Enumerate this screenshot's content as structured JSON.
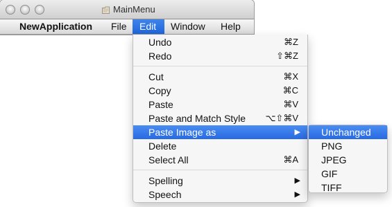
{
  "window": {
    "title": "MainMenu",
    "icon": "document-icon"
  },
  "menubar": {
    "items": [
      {
        "label": "NewApplication"
      },
      {
        "label": "File"
      },
      {
        "label": "Edit"
      },
      {
        "label": "Window"
      },
      {
        "label": "Help"
      }
    ]
  },
  "edit_menu": {
    "items": [
      {
        "label": "Undo",
        "shortcut": "⌘Z"
      },
      {
        "label": "Redo",
        "shortcut": "⇧⌘Z"
      },
      {
        "label": "Cut",
        "shortcut": "⌘X"
      },
      {
        "label": "Copy",
        "shortcut": "⌘C"
      },
      {
        "label": "Paste",
        "shortcut": "⌘V"
      },
      {
        "label": "Paste and Match Style",
        "shortcut": "⌥⇧⌘V"
      },
      {
        "label": "Paste Image as",
        "shortcut": "▶"
      },
      {
        "label": "Delete"
      },
      {
        "label": "Select All",
        "shortcut": "⌘A"
      },
      {
        "label": "Spelling",
        "shortcut": "▶"
      },
      {
        "label": "Speech",
        "shortcut": "▶"
      }
    ]
  },
  "paste_image_submenu": {
    "items": [
      {
        "label": "Unchanged"
      },
      {
        "label": "PNG"
      },
      {
        "label": "JPEG"
      },
      {
        "label": "GIF"
      },
      {
        "label": "TIFF"
      }
    ]
  },
  "colors": {
    "highlight": "#2869e2",
    "menu_background": "#f6f6f6",
    "title_bar": "#d8d8d8"
  }
}
